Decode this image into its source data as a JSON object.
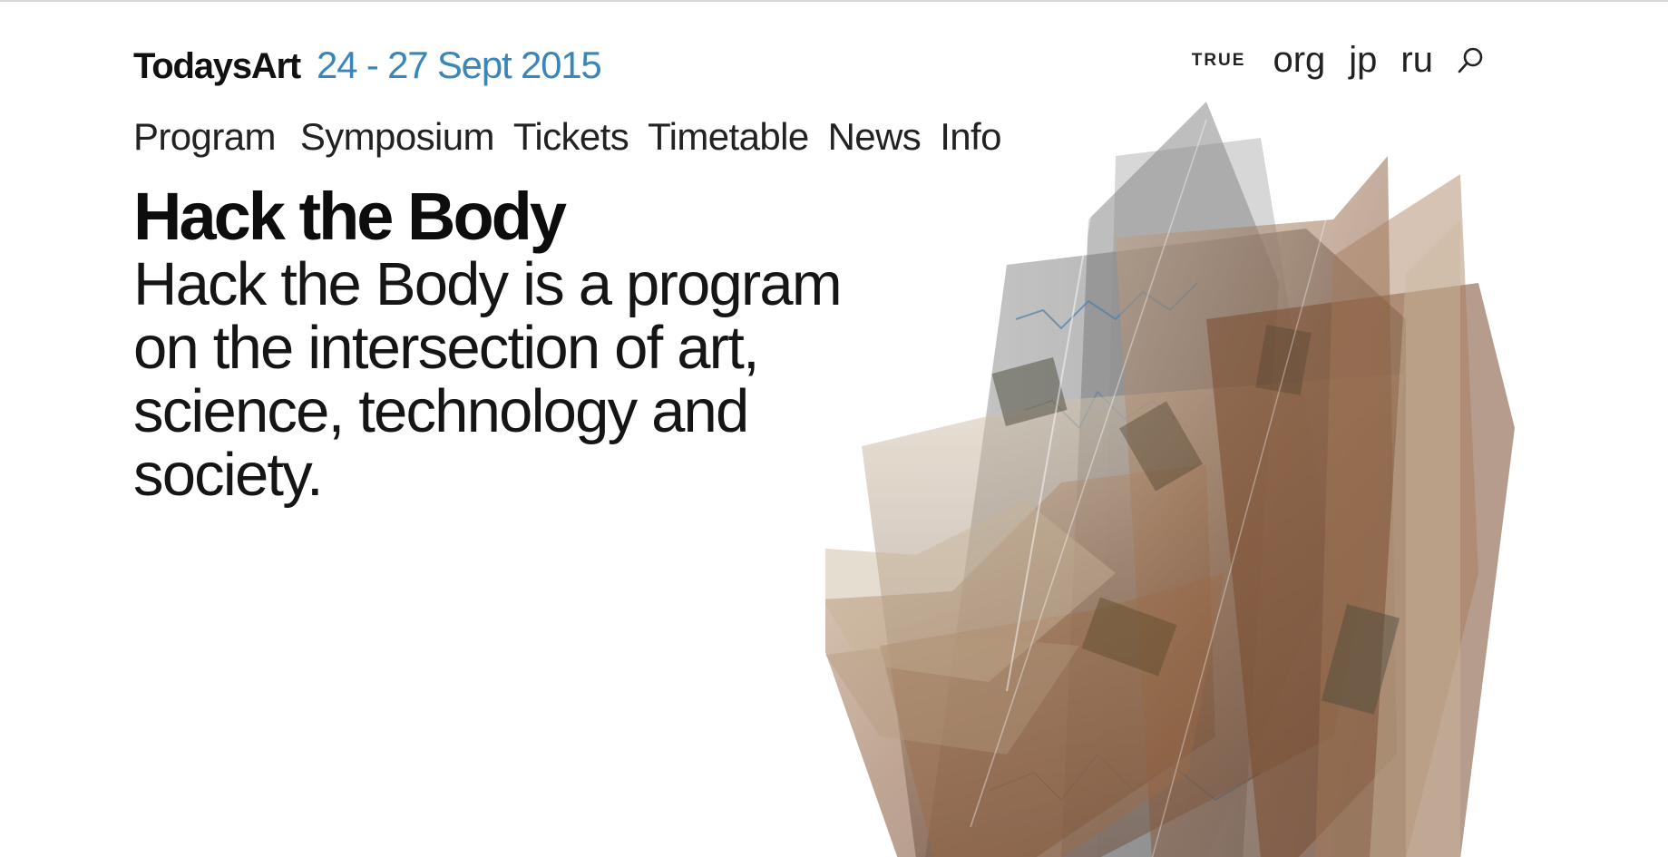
{
  "header": {
    "brand": "TodaysArt",
    "dates": "24 - 27 Sept 2015"
  },
  "top_links": {
    "logo": "TRUE",
    "languages": [
      "org",
      "jp",
      "ru"
    ],
    "search_icon": "search-icon"
  },
  "nav": {
    "items": [
      "Program",
      "Symposium",
      "Tickets",
      "Timetable",
      "News",
      "Info"
    ]
  },
  "main": {
    "title": "Hack the Body",
    "description": "Hack the Body is a program on the intersection of art, science, technology and society."
  },
  "colors": {
    "accent": "#3a86b8",
    "text": "#111111",
    "background": "#ffffff"
  }
}
